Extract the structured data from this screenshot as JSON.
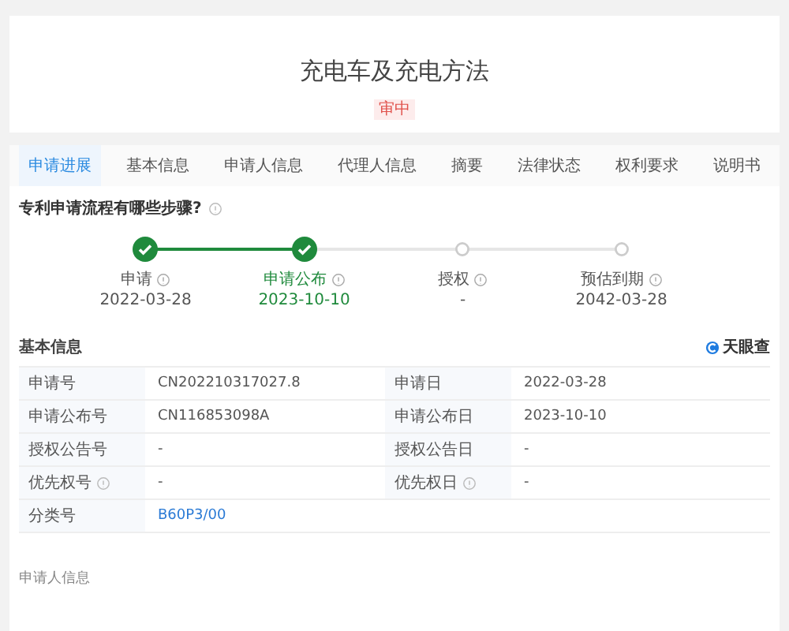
{
  "header": {
    "title": "充电车及充电方法",
    "status": "审中"
  },
  "tabs": [
    {
      "label": "申请进展",
      "selected": true
    },
    {
      "label": "基本信息",
      "selected": false
    },
    {
      "label": "申请人信息",
      "selected": false
    },
    {
      "label": "代理人信息",
      "selected": false
    },
    {
      "label": "摘要",
      "selected": false
    },
    {
      "label": "法律状态",
      "selected": false
    },
    {
      "label": "权利要求",
      "selected": false
    },
    {
      "label": "说明书",
      "selected": false
    }
  ],
  "progress": {
    "title": "专利申请流程有哪些步骤?",
    "steps": [
      {
        "label": "申请",
        "date": "2022-03-28",
        "done": true,
        "selected": false
      },
      {
        "label": "申请公布",
        "date": "2023-10-10",
        "done": true,
        "selected": true
      },
      {
        "label": "授权",
        "date": "-",
        "done": false,
        "selected": false
      },
      {
        "label": "预估到期",
        "date": "2042-03-28",
        "done": false,
        "selected": false
      }
    ]
  },
  "basic_info": {
    "title": "基本信息",
    "source": "天眼查",
    "rows": [
      [
        {
          "label": "申请号",
          "help": false,
          "value": "CN202210317027.8",
          "link": false
        },
        {
          "label": "申请日",
          "help": false,
          "value": "2022-03-28",
          "link": false
        }
      ],
      [
        {
          "label": "申请公布号",
          "help": false,
          "value": "CN116853098A",
          "link": false
        },
        {
          "label": "申请公布日",
          "help": false,
          "value": "2023-10-10",
          "link": false
        }
      ],
      [
        {
          "label": "授权公告号",
          "help": false,
          "value": "-",
          "link": false
        },
        {
          "label": "授权公告日",
          "help": false,
          "value": "-",
          "link": false
        }
      ],
      [
        {
          "label": "优先权号",
          "help": true,
          "value": "-",
          "link": false
        },
        {
          "label": "优先权日",
          "help": true,
          "value": "-",
          "link": false
        }
      ],
      [
        {
          "label": "分类号",
          "help": false,
          "value": "B60P3/00",
          "link": true
        }
      ]
    ]
  },
  "applicant_section": {
    "title": "申请人信息"
  }
}
